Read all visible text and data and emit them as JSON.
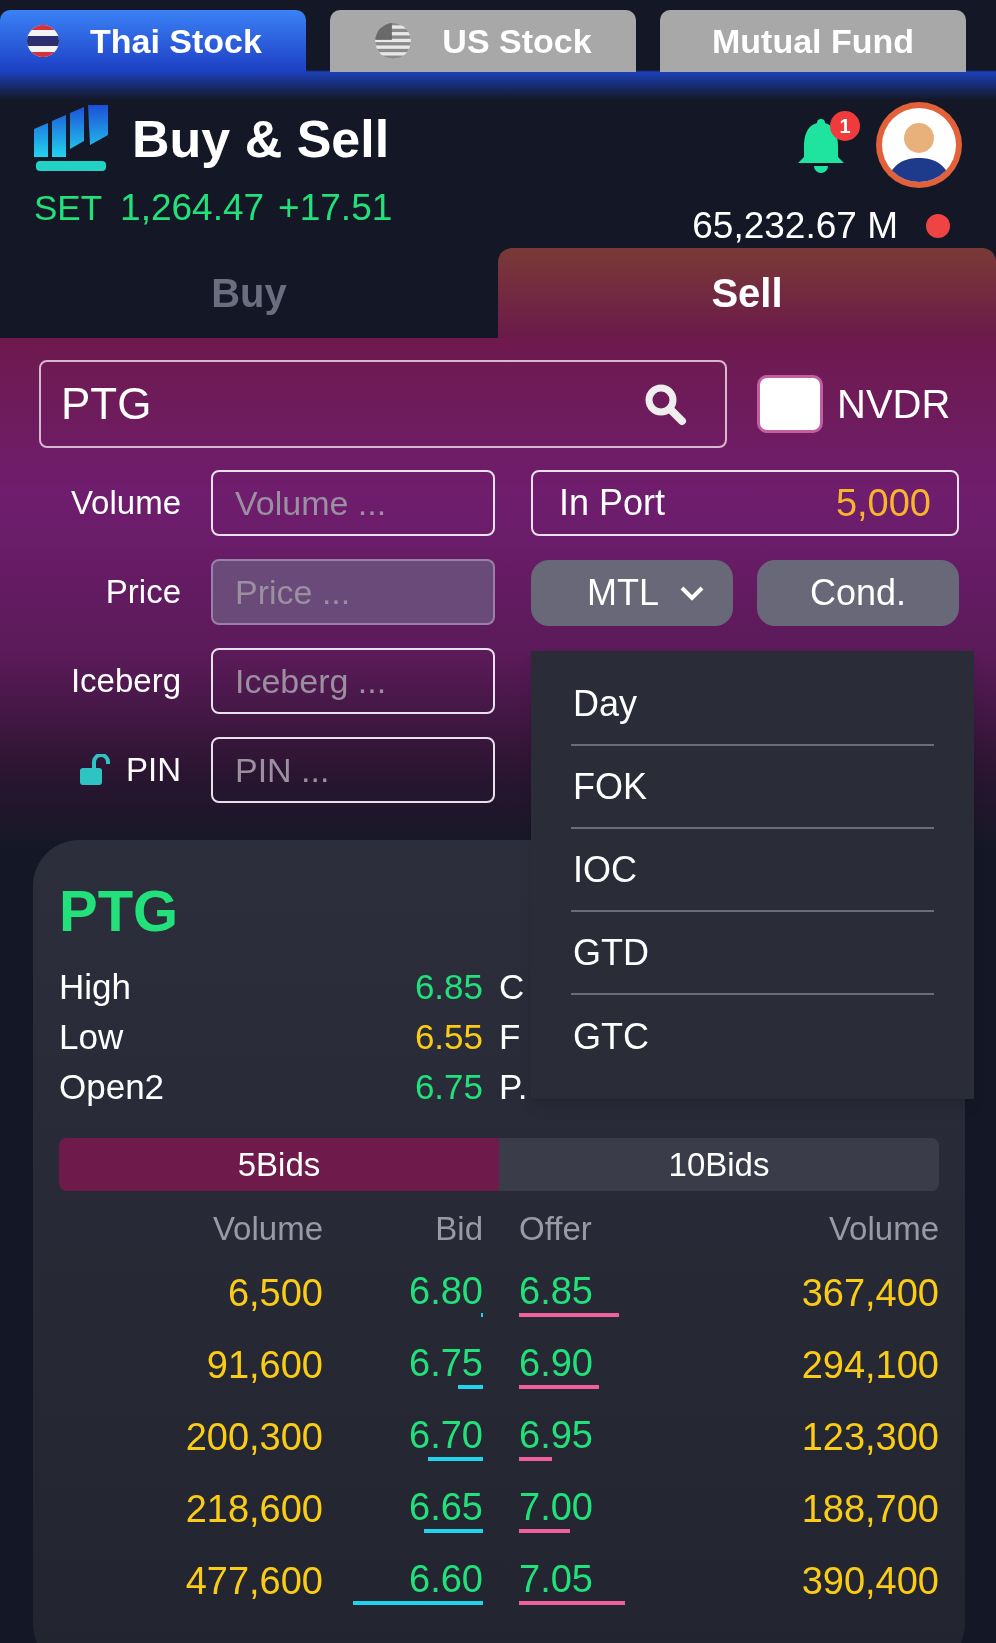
{
  "market_tabs": [
    {
      "label": "Thai Stock",
      "selected": true,
      "kind": "thai"
    },
    {
      "label": "US Stock",
      "selected": false,
      "kind": "us"
    },
    {
      "label": "Mutual Fund",
      "selected": false,
      "kind": "plain"
    }
  ],
  "header": {
    "title": "Buy & Sell",
    "index_name": "SET",
    "index_value": "1,264.47",
    "index_change": "+17.51",
    "notification_count": "1",
    "value": "65,232.67 M"
  },
  "side_tabs": [
    {
      "label": "Buy",
      "selected": false
    },
    {
      "label": "Sell",
      "selected": true
    }
  ],
  "form": {
    "symbol": "PTG",
    "nvdr": {
      "label": "NVDR",
      "checked": false
    },
    "fields": [
      {
        "label": "Volume",
        "placeholder": "Volume ...",
        "disabled": false,
        "kind": "text"
      },
      {
        "label": "Price",
        "placeholder": "Price ...",
        "disabled": true,
        "kind": "text"
      },
      {
        "label": "Iceberg",
        "placeholder": "Iceberg ...",
        "disabled": false,
        "kind": "text"
      },
      {
        "label": "PIN",
        "placeholder": "PIN ...",
        "disabled": false,
        "kind": "pin"
      }
    ],
    "in_port": {
      "label": "In Port",
      "value": "5,000"
    },
    "order_type": "MTL",
    "condition_button": "Cond.",
    "dropdown": [
      "Day",
      "FOK",
      "IOC",
      "GTD",
      "GTC"
    ]
  },
  "quote": {
    "symbol": "PTG",
    "stats": [
      {
        "label": "High",
        "value": "6.85",
        "color": "#22e07a",
        "label_2": "C"
      },
      {
        "label": "Low",
        "value": "6.55",
        "color": "#facc15",
        "label_2": "F"
      },
      {
        "label": "Open2",
        "value": "6.75",
        "color": "#22e07a",
        "label_2": "P."
      }
    ],
    "depth_tabs": [
      {
        "label": "5Bids",
        "selected": true
      },
      {
        "label": "10Bids",
        "selected": false
      }
    ],
    "columns": [
      "Volume",
      "Bid",
      "Offer",
      "Volume"
    ],
    "rows": [
      {
        "bid_volume": "6,500",
        "bid": "6.80",
        "offer": "6.85",
        "offer_volume": "367,400"
      },
      {
        "bid_volume": "91,600",
        "bid": "6.75",
        "offer": "6.90",
        "offer_volume": "294,100"
      },
      {
        "bid_volume": "200,300",
        "bid": "6.70",
        "offer": "6.95",
        "offer_volume": "123,300"
      },
      {
        "bid_volume": "218,600",
        "bid": "6.65",
        "offer": "7.00",
        "offer_volume": "188,700"
      },
      {
        "bid_volume": "477,600",
        "bid": "6.60",
        "offer": "7.05",
        "offer_volume": "390,400"
      }
    ]
  }
}
